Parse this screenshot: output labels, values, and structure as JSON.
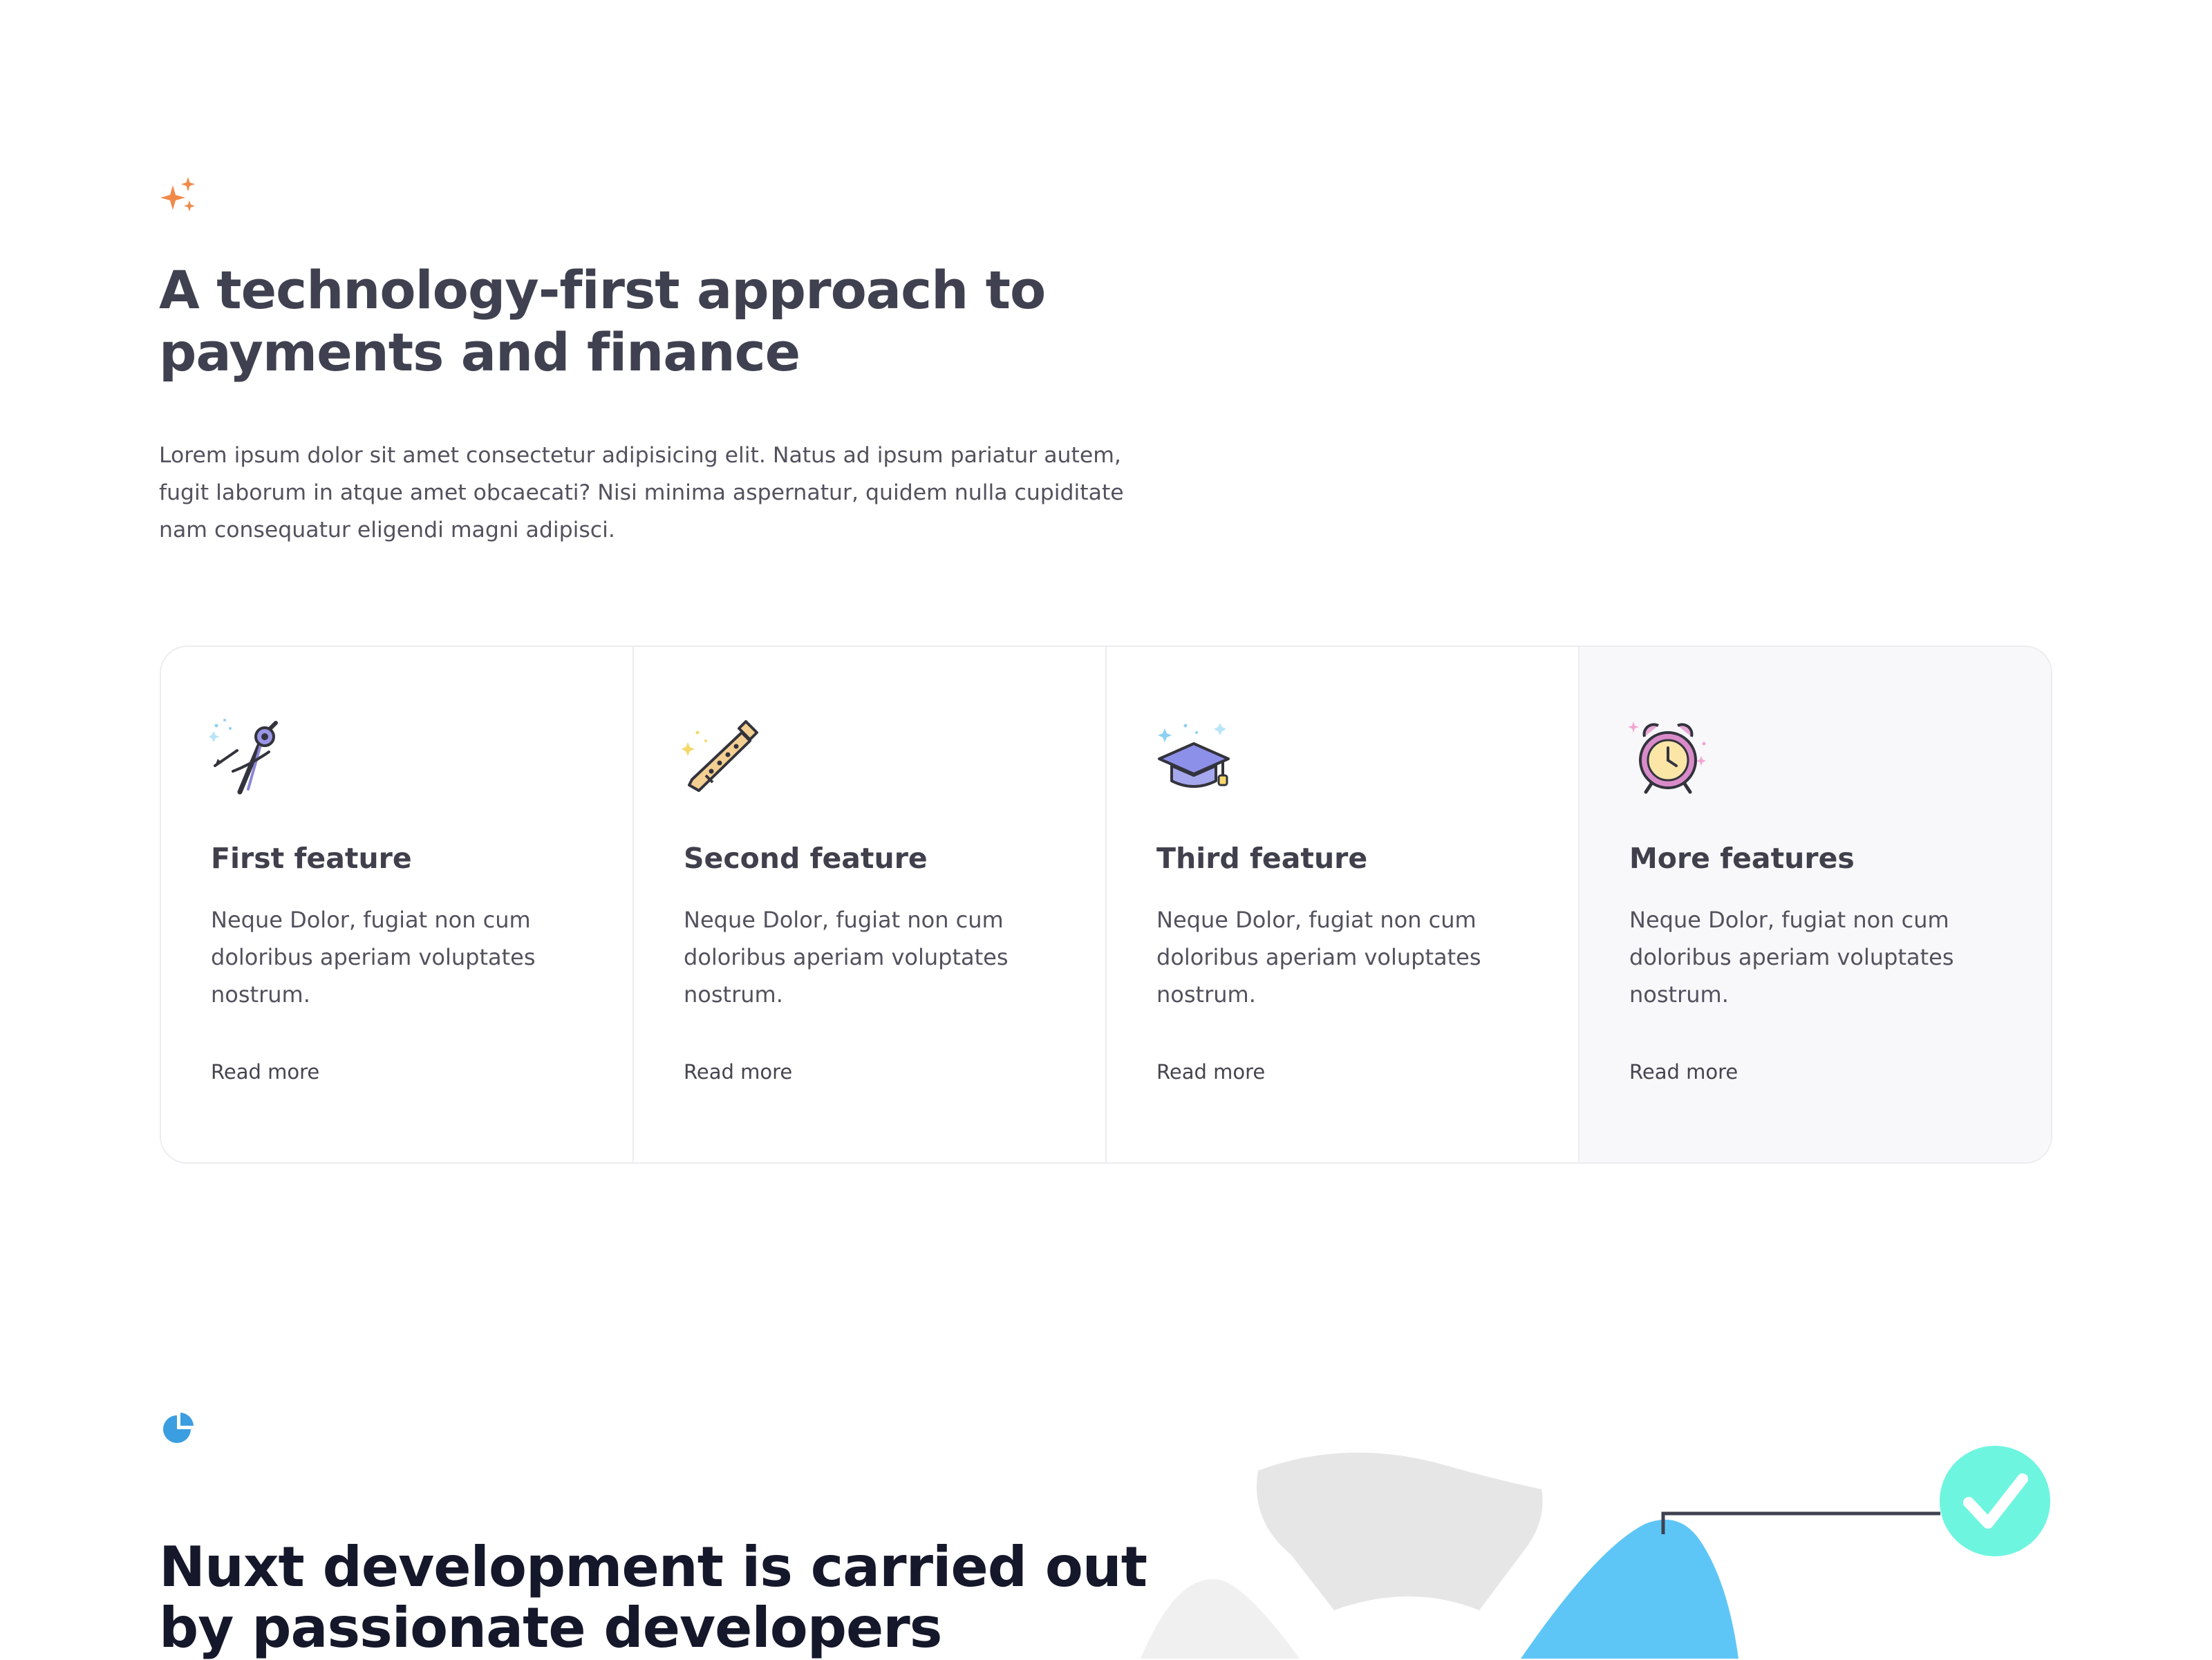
{
  "section1": {
    "badge_icon": "sparkles-icon",
    "title": "A technology-first approach to payments and finance",
    "intro": "Lorem ipsum dolor sit amet consectetur adipisicing elit. Natus ad ipsum pariatur autem, fugit laborum in atque amet obcaecati? Nisi minima aspernatur, quidem nulla cupiditate nam consequatur eligendi magni adipisci.",
    "cards": [
      {
        "icon": "compass-drawing-icon",
        "title": "First feature",
        "desc": "Neque Dolor, fugiat non cum doloribus aperiam voluptates nostrum.",
        "link": "Read more"
      },
      {
        "icon": "recorder-flute-icon",
        "title": "Second feature",
        "desc": "Neque Dolor, fugiat non cum doloribus aperiam voluptates nostrum.",
        "link": "Read more"
      },
      {
        "icon": "graduation-cap-icon",
        "title": "Third feature",
        "desc": "Neque Dolor, fugiat non cum doloribus aperiam voluptates nostrum.",
        "link": "Read more"
      },
      {
        "icon": "alarm-clock-icon",
        "title": "More features",
        "desc": "Neque Dolor, fugiat non cum doloribus aperiam voluptates nostrum.",
        "link": "Read more"
      }
    ]
  },
  "section2": {
    "badge_icon": "pie-chart-icon",
    "title": "Nuxt development is carried out by passionate developers",
    "illustration_icon": "checkmark-circle-icon"
  },
  "colors": {
    "heading": "#3f4150",
    "heading_dark": "#15172a",
    "body_text": "#52525e",
    "accent_orange": "#f08a4b",
    "accent_blue": "#3b9ee0",
    "sky": "#5ec6f7",
    "mint": "#6ef5df",
    "card_border": "#ececf0",
    "card_muted_bg": "#f8f8fa"
  }
}
